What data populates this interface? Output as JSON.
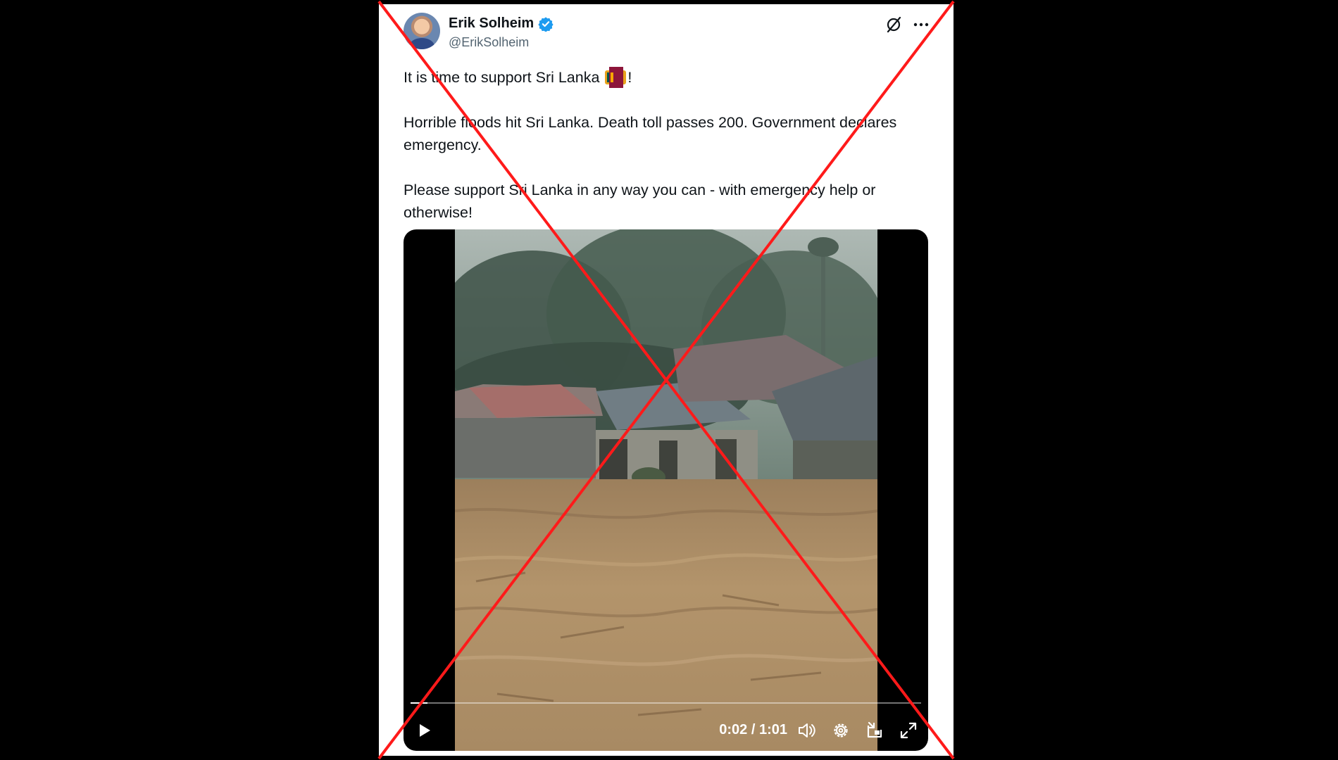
{
  "tweet": {
    "author_name": "Erik Solheim",
    "author_handle": "@ErikSolheim",
    "verified": true,
    "paragraph_1_text": "It is time to support Sri Lanka",
    "paragraph_1_end": "!",
    "flag_icon": "sri-lanka-flag-icon",
    "paragraph_2": "Horrible floods hit Sri Lanka. Death toll passes 200. Government declares emergency.",
    "paragraph_3": "Please support Sri Lanka in any way you can - with emergency help or otherwise!"
  },
  "video": {
    "current_time": "0:02",
    "duration": "1:01",
    "time_display": "0:02 / 1:01",
    "progress_fraction": 0.033
  },
  "icons": {
    "verified": "verified-badge-icon",
    "grok": "grok-icon",
    "more": "more-options-icon",
    "play": "play-icon",
    "volume": "volume-icon",
    "settings": "settings-gear-icon",
    "dock": "picture-in-picture-icon",
    "fullscreen": "fullscreen-icon"
  },
  "colors": {
    "overlay_cross": "#ff1a1a",
    "verified_blue": "#1d9bf0",
    "text_primary": "#0f1419",
    "text_secondary": "#536471",
    "flood_water": "#a88a63"
  }
}
